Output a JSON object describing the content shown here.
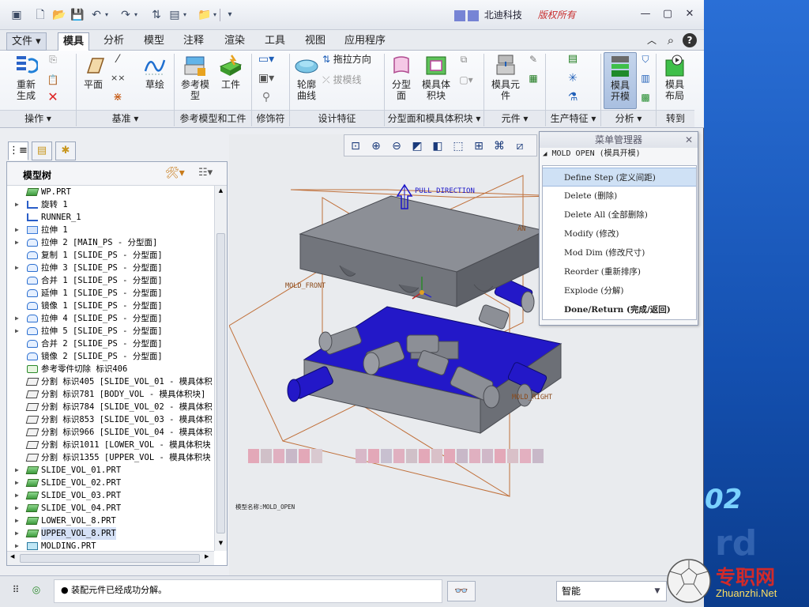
{
  "title_bar": {
    "company": "北迪科技",
    "rights": "版权所有"
  },
  "menu": {
    "tabs": [
      "文件",
      "模具",
      "分析",
      "模型",
      "注释",
      "渲染",
      "工具",
      "视图",
      "应用程序"
    ],
    "active": "模具"
  },
  "ribbon": {
    "regenerate": "重新生成",
    "plane": "平面",
    "sketch": "草绘",
    "ref_model": "参考模型",
    "workpiece": "工件",
    "contour_curve": "轮廓曲线",
    "drag_direction": "拖拉方向",
    "draft_line": "拔模线",
    "parting_surface": "分型面",
    "mold_volume": "模具体积块",
    "mold_component": "模具元件",
    "mold_open": "模具开模",
    "mold_layout": "模具布局",
    "groups": {
      "operations": "操作",
      "datum": "基准",
      "ref_model_workpiece": "参考模型和工件",
      "modifiers": "修饰符",
      "design_features": "设计特征",
      "parting_volume": "分型面和模具体积块",
      "components": "元件",
      "production": "生产特征",
      "analysis": "分析",
      "goto": "转到"
    }
  },
  "model_tree": {
    "title": "模型树",
    "nodes": [
      {
        "label": "WP.PRT",
        "expandable": false,
        "icon": "part-icon"
      },
      {
        "label": "旋转 1",
        "expandable": true,
        "icon": "revolve-icon"
      },
      {
        "label": "RUNNER_1",
        "expandable": false,
        "icon": "runner-icon"
      },
      {
        "label": "拉伸 1",
        "expandable": true,
        "icon": "extrude-icon"
      },
      {
        "label": "拉伸 2 [MAIN_PS - 分型面]",
        "expandable": true,
        "icon": "surface-icon"
      },
      {
        "label": "复制 1 [SLIDE_PS - 分型面]",
        "expandable": false,
        "icon": "surface-icon"
      },
      {
        "label": "拉伸 3 [SLIDE_PS - 分型面]",
        "expandable": true,
        "icon": "surface-icon"
      },
      {
        "label": "合并 1 [SLIDE_PS - 分型面]",
        "expandable": false,
        "icon": "surface-icon"
      },
      {
        "label": "延伸 1 [SLIDE_PS - 分型面]",
        "expandable": false,
        "icon": "surface-icon"
      },
      {
        "label": "镜像 1 [SLIDE_PS - 分型面]",
        "expandable": false,
        "icon": "surface-icon"
      },
      {
        "label": "拉伸 4 [SLIDE_PS - 分型面]",
        "expandable": true,
        "icon": "surface-icon"
      },
      {
        "label": "拉伸 5 [SLIDE_PS - 分型面]",
        "expandable": true,
        "icon": "surface-icon"
      },
      {
        "label": "合并 2 [SLIDE_PS - 分型面]",
        "expandable": false,
        "icon": "surface-icon"
      },
      {
        "label": "镜像 2 [SLIDE_PS - 分型面]",
        "expandable": false,
        "icon": "surface-icon"
      },
      {
        "label": "参考零件切除 标识406",
        "expandable": false,
        "icon": "cut-icon"
      },
      {
        "label": "分割 标识405 [SLIDE_VOL_01 - 模具体积",
        "expandable": false,
        "icon": "split-icon"
      },
      {
        "label": "分割 标识781 [BODY_VOL - 模具体积块]",
        "expandable": false,
        "icon": "split-icon"
      },
      {
        "label": "分割 标识784 [SLIDE_VOL_02 - 模具体积",
        "expandable": false,
        "icon": "split-icon"
      },
      {
        "label": "分割 标识853 [SLIDE_VOL_03 - 模具体积",
        "expandable": false,
        "icon": "split-icon"
      },
      {
        "label": "分割 标识966 [SLIDE_VOL_04 - 模具体积",
        "expandable": false,
        "icon": "split-icon"
      },
      {
        "label": "分割 标识1011 [LOWER_VOL - 模具体积块",
        "expandable": false,
        "icon": "split-icon"
      },
      {
        "label": "分割 标识1355 [UPPER_VOL - 模具体积块",
        "expandable": false,
        "icon": "split-icon"
      },
      {
        "label": "SLIDE_VOL_01.PRT",
        "expandable": true,
        "icon": "part-icon"
      },
      {
        "label": "SLIDE_VOL_02.PRT",
        "expandable": true,
        "icon": "part-icon"
      },
      {
        "label": "SLIDE_VOL_03.PRT",
        "expandable": true,
        "icon": "part-icon"
      },
      {
        "label": "SLIDE_VOL_04.PRT",
        "expandable": true,
        "icon": "part-icon"
      },
      {
        "label": "LOWER_VOL_8.PRT",
        "expandable": true,
        "icon": "part-icon"
      },
      {
        "label": "UPPER_VOL_8.PRT",
        "expandable": true,
        "icon": "part-icon",
        "selected": true
      },
      {
        "label": "MOLDING.PRT",
        "expandable": true,
        "icon": "molding-icon"
      }
    ]
  },
  "graphics": {
    "labels": {
      "pull_direction": "PULL DIRECTION",
      "mold_front": "MOLD_FRONT",
      "mold_right": "MOLD_RIGHT",
      "partial": "AN"
    },
    "model_name": "模型名称:MOLD_OPEN"
  },
  "menu_manager": {
    "title": "菜单管理器",
    "header": "MOLD OPEN (模具开模)",
    "items": [
      {
        "label": "Define Step (定义间距)",
        "highlighted": true
      },
      {
        "label": "Delete (删除)"
      },
      {
        "label": "Delete All (全部删除)"
      },
      {
        "label": "Modify (修改)"
      },
      {
        "label": "Mod Dim (修改尺寸)"
      },
      {
        "label": "Reorder (重新排序)"
      },
      {
        "label": "Explode (分解)"
      },
      {
        "label": "Done/Return (完成/返回)",
        "bold": true
      }
    ]
  },
  "status": {
    "message": "● 装配元件已经成功分解。",
    "filter": "智能"
  },
  "watermark": {
    "text": "专职网",
    "url": "Zhuanzhi.Net",
    "deco": "02"
  },
  "colors": {
    "mold_blue": "#1a14c8",
    "mold_grey": "#8c8f96",
    "outline_orange": "#c0703a",
    "highlight": "#cfe1f5"
  }
}
